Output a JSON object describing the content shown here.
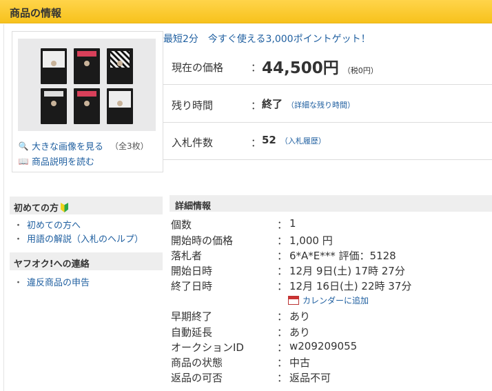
{
  "header": {
    "title": "商品の情報"
  },
  "thumb": {
    "large_image_link": "大きな画像を見る",
    "image_count": "（全3枚）",
    "description_link": "商品説明を読む"
  },
  "promo": "最短2分　今すぐ使える3,000ポイントゲット！",
  "price_rows": {
    "current_price": {
      "label": "現在の価格",
      "value": "44,500円",
      "sub": "（税0円）"
    },
    "time_left": {
      "label": "残り時間",
      "value": "終了",
      "sub": "（詳細な残り時間）"
    },
    "bids": {
      "label": "入札件数",
      "value": "52",
      "sub": "（入札履歴）"
    }
  },
  "sidebar": {
    "beginners_heading": "初めての方",
    "beginners_items": [
      "初めての方へ",
      "用語の解説（入札のヘルプ）"
    ],
    "contact_heading": "ヤフオク!への連絡",
    "contact_items": [
      "違反商品の申告"
    ]
  },
  "details": {
    "heading": "詳細情報",
    "colon": "：",
    "rows": [
      {
        "key": "個数",
        "value": "1"
      },
      {
        "key": "開始時の価格",
        "value": "1,000 円"
      },
      {
        "key": "落札者",
        "value": "6*A*E*** 評価：5128"
      },
      {
        "key": "開始日時",
        "value": "12月 9日(土) 17時 27分"
      },
      {
        "key": "終了日時",
        "value": "12月 16日(土) 22時 37分"
      },
      {
        "key": "早期終了",
        "value": "あり"
      },
      {
        "key": "自動延長",
        "value": "あり"
      },
      {
        "key": "オークションID",
        "value": "w209209055"
      },
      {
        "key": "商品の状態",
        "value": "中古"
      },
      {
        "key": "返品の可否",
        "value": "返品不可"
      }
    ],
    "calendar_link": "カレンダーに追加"
  },
  "colors": {
    "header_bg": "#f7c21c",
    "link": "#1f5fa0"
  }
}
